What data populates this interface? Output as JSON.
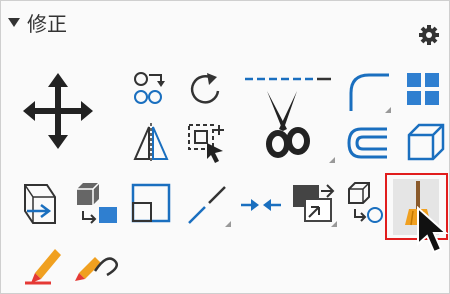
{
  "panel": {
    "title": "修正",
    "tools": [
      {
        "name": "move",
        "icon": "move-arrows-icon"
      },
      {
        "name": "copy",
        "icon": "copy-icon"
      },
      {
        "name": "rotate",
        "icon": "rotate-icon"
      },
      {
        "name": "mirror",
        "icon": "mirror-icon"
      },
      {
        "name": "stretch",
        "icon": "stretch-icon"
      },
      {
        "name": "trim",
        "icon": "scissors-icon"
      },
      {
        "name": "fillet",
        "icon": "fillet-icon"
      },
      {
        "name": "array",
        "icon": "array-icon"
      },
      {
        "name": "offset",
        "icon": "offset-icon"
      },
      {
        "name": "3d-solid",
        "icon": "cube-icon"
      },
      {
        "name": "align",
        "icon": "align-icon"
      },
      {
        "name": "copy-base",
        "icon": "copy-base-icon"
      },
      {
        "name": "scale",
        "icon": "scale-icon"
      },
      {
        "name": "break",
        "icon": "break-icon"
      },
      {
        "name": "join",
        "icon": "join-icon"
      },
      {
        "name": "draw-order",
        "icon": "draw-order-icon"
      },
      {
        "name": "copy-nested",
        "icon": "copy-nested-icon"
      },
      {
        "name": "erase",
        "icon": "broom-icon"
      },
      {
        "name": "edit-polyline",
        "icon": "pencil-icon"
      },
      {
        "name": "edit-spline",
        "icon": "pencil-curve-icon"
      }
    ],
    "selected_tool": "erase"
  },
  "colors": {
    "accent": "#1a6fbf",
    "blue": "#2f7fd0",
    "highlight": "#e11d1d",
    "orange": "#f0a020",
    "red": "#e53935"
  }
}
